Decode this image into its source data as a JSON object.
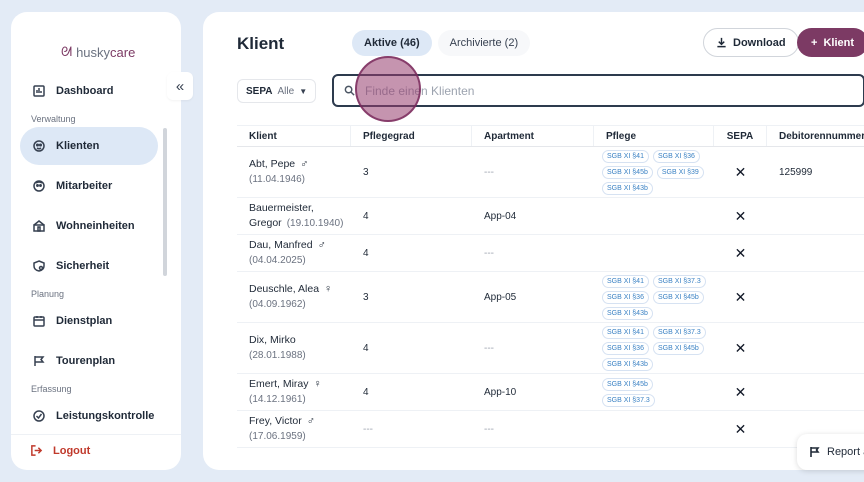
{
  "app": {
    "logo_husky": "husky",
    "logo_care": "care",
    "collapse_icon": "«"
  },
  "sidebar": {
    "sections": {
      "verwaltung": "Verwaltung",
      "planung": "Planung",
      "erfassung": "Erfassung"
    },
    "items": [
      {
        "label": "Dashboard",
        "icon": "dashboard-icon"
      },
      {
        "label": "Klienten",
        "icon": "klienten-icon"
      },
      {
        "label": "Mitarbeiter",
        "icon": "mitarbeiter-icon"
      },
      {
        "label": "Wohneinheiten",
        "icon": "wohneinheiten-icon"
      },
      {
        "label": "Sicherheit",
        "icon": "sicherheit-icon"
      },
      {
        "label": "Dienstplan",
        "icon": "calendar-icon"
      },
      {
        "label": "Tourenplan",
        "icon": "flag-icon"
      },
      {
        "label": "Leistungskontrolle",
        "icon": "check-icon"
      }
    ],
    "logout_label": "Logout"
  },
  "header": {
    "title": "Klient",
    "tabs": [
      {
        "label": "Aktive (46)",
        "active": true
      },
      {
        "label": "Archivierte (2)",
        "active": false
      }
    ],
    "download_label": "Download",
    "add_label": "Klient",
    "add_icon": "+"
  },
  "filters": {
    "sepa_label": "SEPA",
    "sepa_value": "Alle",
    "search_placeholder": "Finde einen Klienten",
    "search_value": ""
  },
  "table": {
    "columns": [
      "Klient",
      "Pflegegrad",
      "Apartment",
      "Pflege",
      "SEPA",
      "Debitorennummer"
    ],
    "rows": [
      {
        "name": "Abt, Pepe",
        "dob": "(11.04.1946)",
        "gender": "♂",
        "grad": "3",
        "apt": "---",
        "pflege": [
          "SGB XI §41",
          "SGB XI §36",
          "SGB XI §45b",
          "SGB XI §39",
          "SGB XI §43b"
        ],
        "sepa": "✕",
        "deb": "125999"
      },
      {
        "name": "Bauermeister,",
        "name2": "Gregor",
        "dob": "(19.10.1940)",
        "gender": "",
        "grad": "4",
        "apt": "App-04",
        "pflege": [],
        "sepa": "✕",
        "deb": ""
      },
      {
        "name": "Dau, Manfred",
        "dob": "(04.04.2025)",
        "gender": "♂",
        "grad": "4",
        "apt": "---",
        "pflege": [],
        "sepa": "✕",
        "deb": ""
      },
      {
        "name": "Deuschle, Alea",
        "dob": "(04.09.1962)",
        "gender": "♀",
        "grad": "3",
        "apt": "App-05",
        "pflege": [
          "SGB XI §41",
          "SGB XI §37.3",
          "SGB XI §36",
          "SGB XI §45b",
          "SGB XI §43b"
        ],
        "sepa": "✕",
        "deb": ""
      },
      {
        "name": "Dix, Mirko",
        "dob": "(28.01.1988)",
        "gender": "",
        "grad": "4",
        "apt": "---",
        "pflege": [
          "SGB XI §41",
          "SGB XI §37.3",
          "SGB XI §36",
          "SGB XI §45b",
          "SGB XI §43b"
        ],
        "sepa": "✕",
        "deb": ""
      },
      {
        "name": "Emert, Miray",
        "dob": "(14.12.1961)",
        "gender": "♀",
        "grad": "4",
        "apt": "App-10",
        "pflege": [
          "SGB XI §45b",
          "SGB XI §37.3"
        ],
        "sepa": "✕",
        "deb": ""
      },
      {
        "name": "Frey, Victor",
        "dob": "(17.06.1959)",
        "gender": "♂",
        "grad": "---",
        "apt": "---",
        "pflege": [],
        "sepa": "✕",
        "deb": ""
      }
    ]
  },
  "report": {
    "label": "Report a"
  }
}
